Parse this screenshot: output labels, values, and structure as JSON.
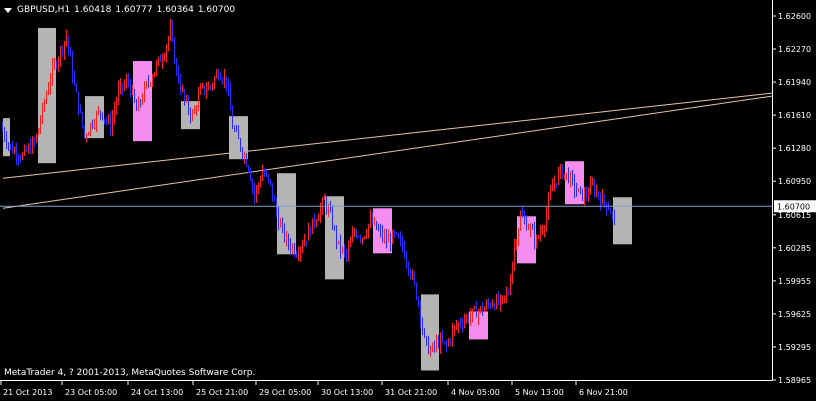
{
  "header": {
    "symbol_timeframe": "GBPUSD,H1",
    "open": "1.60418",
    "high": "1.60777",
    "low": "1.60364",
    "close": "1.60700"
  },
  "copyright": "MetaTrader 4, ? 2001-2013, MetaQuotes Software Corp.",
  "colors": {
    "background": "#000000",
    "axis": "#ffffff",
    "bull": "#ff2020",
    "bear": "#2b2bff",
    "box_gray": "#b4b4b4",
    "box_pink": "#f58cf0",
    "trendline": "#e8c7a0",
    "price_line": "#7f9fd0"
  },
  "chart_data": {
    "type": "candlestick",
    "y_ticks": [
      "1.62600",
      "1.62270",
      "1.61940",
      "1.61610",
      "1.61280",
      "1.60950",
      "1.60615",
      "1.60285",
      "1.59955",
      "1.59625",
      "1.59295",
      "1.58965"
    ],
    "x_ticks": [
      "21 Oct 2013",
      "23 Oct 05:00",
      "24 Oct 13:00",
      "25 Oct 21:00",
      "29 Oct 05:00",
      "30 Oct 13:00",
      "31 Oct 21:00",
      "4 Nov 05:00",
      "5 Nov 13:00",
      "6 Nov 21:00"
    ],
    "current_price": "1.60700",
    "ylim": [
      1.58965,
      1.626
    ],
    "price_path": [
      [
        0,
        1.615
      ],
      [
        10,
        1.6128
      ],
      [
        22,
        1.612
      ],
      [
        35,
        1.6135
      ],
      [
        50,
        1.62
      ],
      [
        58,
        1.622
      ],
      [
        66,
        1.624
      ],
      [
        74,
        1.619
      ],
      [
        84,
        1.614
      ],
      [
        92,
        1.6155
      ],
      [
        100,
        1.6165
      ],
      [
        110,
        1.615
      ],
      [
        118,
        1.6185
      ],
      [
        128,
        1.6195
      ],
      [
        136,
        1.6165
      ],
      [
        146,
        1.619
      ],
      [
        156,
        1.621
      ],
      [
        164,
        1.6225
      ],
      [
        170,
        1.6245
      ],
      [
        176,
        1.6205
      ],
      [
        184,
        1.6175
      ],
      [
        192,
        1.616
      ],
      [
        200,
        1.6185
      ],
      [
        210,
        1.619
      ],
      [
        218,
        1.6205
      ],
      [
        226,
        1.6195
      ],
      [
        232,
        1.615
      ],
      [
        240,
        1.613
      ],
      [
        248,
        1.611
      ],
      [
        254,
        1.608
      ],
      [
        262,
        1.6105
      ],
      [
        270,
        1.609
      ],
      [
        278,
        1.6055
      ],
      [
        286,
        1.6035
      ],
      [
        296,
        1.6025
      ],
      [
        306,
        1.604
      ],
      [
        316,
        1.606
      ],
      [
        324,
        1.6075
      ],
      [
        330,
        1.606
      ],
      [
        338,
        1.603
      ],
      [
        346,
        1.602
      ],
      [
        354,
        1.6045
      ],
      [
        362,
        1.604
      ],
      [
        370,
        1.6055
      ],
      [
        378,
        1.6045
      ],
      [
        386,
        1.6035
      ],
      [
        394,
        1.604
      ],
      [
        402,
        1.603
      ],
      [
        410,
        1.6005
      ],
      [
        418,
        1.5975
      ],
      [
        424,
        1.5935
      ],
      [
        430,
        1.5925
      ],
      [
        438,
        1.5935
      ],
      [
        446,
        1.593
      ],
      [
        452,
        1.5945
      ],
      [
        460,
        1.5955
      ],
      [
        468,
        1.596
      ],
      [
        476,
        1.5965
      ],
      [
        484,
        1.5968
      ],
      [
        492,
        1.5975
      ],
      [
        500,
        1.5972
      ],
      [
        508,
        1.5985
      ],
      [
        514,
        1.603
      ],
      [
        520,
        1.606
      ],
      [
        528,
        1.605
      ],
      [
        536,
        1.6035
      ],
      [
        544,
        1.6055
      ],
      [
        552,
        1.609
      ],
      [
        560,
        1.6105
      ],
      [
        568,
        1.61
      ],
      [
        576,
        1.6085
      ],
      [
        584,
        1.608
      ],
      [
        592,
        1.609
      ],
      [
        600,
        1.6078
      ],
      [
        608,
        1.607
      ],
      [
        614,
        1.6055
      ]
    ],
    "boxes": [
      {
        "x": 3,
        "w": 7,
        "top": 1.6158,
        "bottom": 1.612,
        "color": "gray"
      },
      {
        "x": 38,
        "w": 18,
        "top": 1.6248,
        "bottom": 1.6113,
        "color": "gray"
      },
      {
        "x": 85,
        "w": 19,
        "top": 1.618,
        "bottom": 1.6138,
        "color": "gray"
      },
      {
        "x": 133,
        "w": 19,
        "top": 1.6215,
        "bottom": 1.6135,
        "color": "pink"
      },
      {
        "x": 181,
        "w": 19,
        "top": 1.6175,
        "bottom": 1.6147,
        "color": "gray"
      },
      {
        "x": 229,
        "w": 19,
        "top": 1.616,
        "bottom": 1.6117,
        "color": "gray"
      },
      {
        "x": 277,
        "w": 19,
        "top": 1.6103,
        "bottom": 1.6022,
        "color": "gray"
      },
      {
        "x": 325,
        "w": 19,
        "top": 1.608,
        "bottom": 1.5997,
        "color": "gray"
      },
      {
        "x": 373,
        "w": 19,
        "top": 1.6068,
        "bottom": 1.6023,
        "color": "pink"
      },
      {
        "x": 421,
        "w": 18,
        "top": 1.5982,
        "bottom": 1.5906,
        "color": "gray"
      },
      {
        "x": 469,
        "w": 19,
        "top": 1.5965,
        "bottom": 1.5937,
        "color": "pink"
      },
      {
        "x": 517,
        "w": 19,
        "top": 1.606,
        "bottom": 1.6013,
        "color": "pink"
      },
      {
        "x": 565,
        "w": 19,
        "top": 1.6115,
        "bottom": 1.6072,
        "color": "pink"
      },
      {
        "x": 613,
        "w": 19,
        "top": 1.6079,
        "bottom": 1.6032,
        "color": "gray"
      }
    ],
    "trendlines": [
      {
        "x1": 3,
        "y1": 1.6098,
        "x2": 772,
        "y2": 1.6183
      },
      {
        "x1": 3,
        "y1": 1.6068,
        "x2": 772,
        "y2": 1.618
      }
    ]
  }
}
